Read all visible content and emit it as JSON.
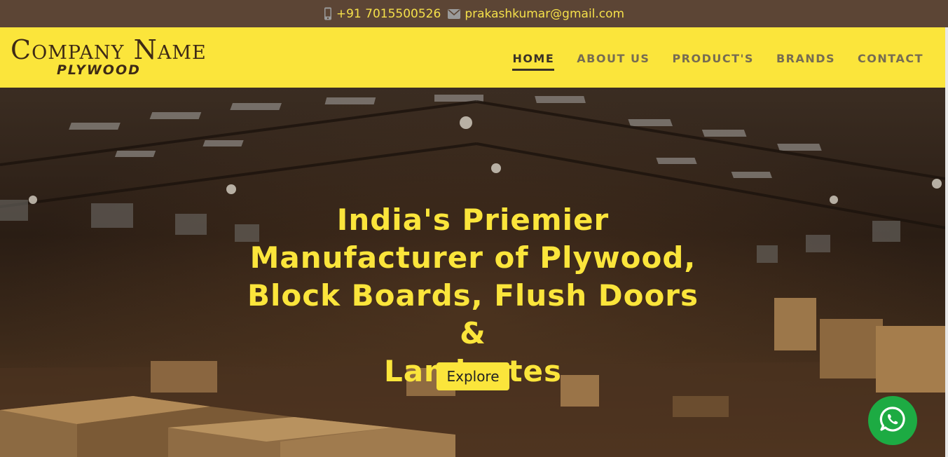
{
  "topbar": {
    "phone": "+91 7015500526",
    "email": "prakashkumar@gmail.com",
    "phone_icon": "mobile-phone-icon",
    "email_icon": "envelope-icon"
  },
  "logo": {
    "name": "Company Name",
    "sub": "PLYWOOD"
  },
  "nav": {
    "items": [
      {
        "label": "HOME",
        "active": true
      },
      {
        "label": "ABOUT US"
      },
      {
        "label": "PRODUCT'S"
      },
      {
        "label": "BRANDS"
      },
      {
        "label": "CONTACT"
      }
    ]
  },
  "hero": {
    "headline_lines": [
      "India's Priemier",
      "Manufacturer of Plywood,",
      "Block Boards, Flush Doors &",
      "Laminates"
    ],
    "button_label": "Explore"
  },
  "floating": {
    "icon": "whatsapp-icon"
  },
  "colors": {
    "topbar_bg": "#5c4535",
    "accent_yellow": "#fbe53b",
    "whatsapp_green": "#1dab43"
  }
}
